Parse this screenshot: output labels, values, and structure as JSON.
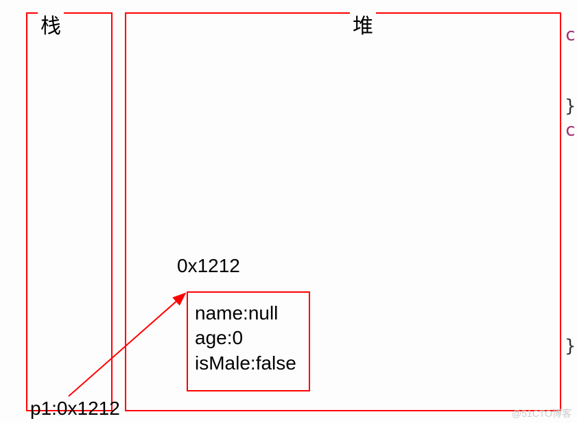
{
  "stack": {
    "label": "栈",
    "variable": "p1:0x1212"
  },
  "heap": {
    "label": "堆",
    "address": "0x1212",
    "object": {
      "name_field": "name:null",
      "age_field": "age:0",
      "isMale_field": "isMale:false"
    }
  },
  "side_fragments": {
    "c1": "c",
    "brace1": "}",
    "c2": "c",
    "brace2": "}"
  },
  "watermark": "@51CTO博客"
}
